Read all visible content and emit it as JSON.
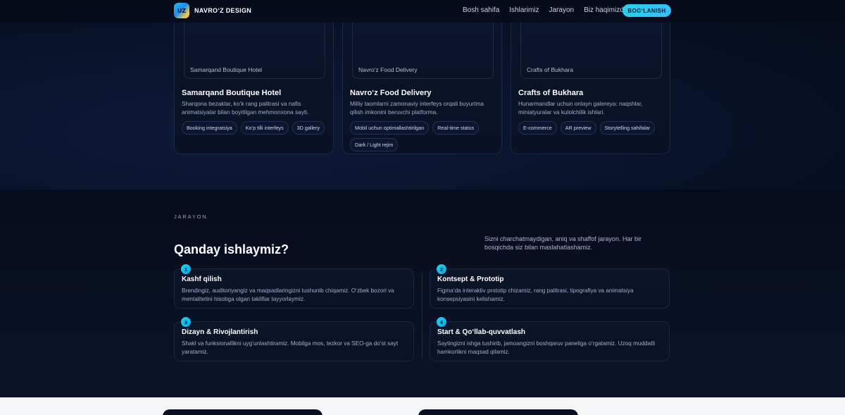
{
  "header": {
    "logo_text": "UZ",
    "brand": "NAVRO‘Z DESIGN",
    "nav": [
      "Bosh sahifa",
      "Ishlarimiz",
      "Jarayon",
      "Biz haqimizda"
    ],
    "cta": "BOG‘LANISH"
  },
  "portfolio": {
    "cards": [
      {
        "thumb_label": "Samarqand Boutique Hotel",
        "title": "Samarqand Boutique Hotel",
        "desc": "Sharqona bezaklar, ko‘k rang palitrasi va nafis animatsiyalar bilan boyitilgan mehmonxona sayti.",
        "tags": [
          "Booking integratsiya",
          "Ko‘p tilli interfeys",
          "3D gallery"
        ]
      },
      {
        "thumb_label": "Navro‘z Food Delivery",
        "title": "Navro‘z Food Delivery",
        "desc": "Milliy taomlarni zamonaviy interfeys orqali buyurtma qilish imkonini beruvchi platforma.",
        "tags": [
          "Mobil uchun optimallashtirilgan",
          "Real-time status",
          "Dark / Light rejim"
        ]
      },
      {
        "thumb_label": "Crafts of Bukhara",
        "title": "Crafts of Bukhara",
        "desc": "Hunarmandlar uchun onlayn galereya: naqshlar, miniatyuralar va kulolchilik ishlari.",
        "tags": [
          "E-commerce",
          "AR preview",
          "Storytelling sahifalar"
        ]
      }
    ]
  },
  "process": {
    "eyebrow": "JARAYON",
    "heading": "Qanday ishlaymiz?",
    "subtext": "Sizni charchatmaydigan, aniq va shaffof jarayon. Har bir bosqichda siz bilan maslahatlashamiz.",
    "steps": [
      {
        "num": "1",
        "title": "Kashf qilish",
        "desc": "Brendingiz, auditoriyangiz va maqsadlaringizni tushunib chiqamiz. O‘zbek bozori va mentalitetini hisobga olgan takliflar tayyorlaymiz."
      },
      {
        "num": "2",
        "title": "Kontsept & Prototip",
        "desc": "Figma’da interaktiv prototip chizamiz, rang palitrasi, tipografiya va animatsiya konsepsiyasini kelishamiz."
      },
      {
        "num": "3",
        "title": "Dizayn & Rivojlantirish",
        "desc": "Shakl va funksionallikni uyg‘unlashtiramiz. Mobilga mos, tezkor va SEO-ga do‘st sayt yaratamiz."
      },
      {
        "num": "4",
        "title": "Start & Qo‘llab-quvvatlash",
        "desc": "Saytingizni ishga tushirib, jamoangizni boshqaruv paneliga o‘rgatamiz. Uzoq muddatli hamkorlikni maqsad qilamiz."
      }
    ]
  },
  "colors": {
    "accent": "#22d3ee",
    "background": "#060b1a",
    "card": "#0b1328"
  }
}
